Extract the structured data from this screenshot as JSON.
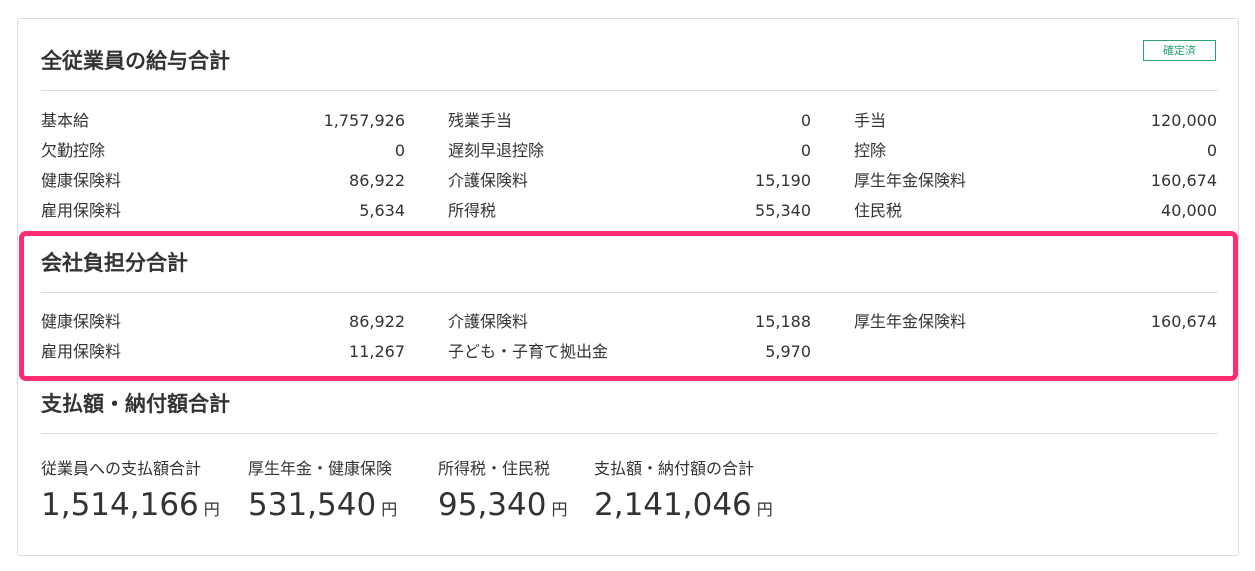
{
  "salary_total": {
    "title": "全従業員の給与合計",
    "status_badge": "確定済",
    "items": [
      {
        "label": "基本給",
        "value": "1,757,926"
      },
      {
        "label": "残業手当",
        "value": "0"
      },
      {
        "label": "手当",
        "value": "120,000"
      },
      {
        "label": "欠勤控除",
        "value": "0"
      },
      {
        "label": "遅刻早退控除",
        "value": "0"
      },
      {
        "label": "控除",
        "value": "0"
      },
      {
        "label": "健康保険料",
        "value": "86,922"
      },
      {
        "label": "介護保険料",
        "value": "15,190"
      },
      {
        "label": "厚生年金保険料",
        "value": "160,674"
      },
      {
        "label": "雇用保険料",
        "value": "5,634"
      },
      {
        "label": "所得税",
        "value": "55,340"
      },
      {
        "label": "住民税",
        "value": "40,000"
      }
    ]
  },
  "company_burden": {
    "title": "会社負担分合計",
    "items": [
      {
        "label": "健康保険料",
        "value": "86,922"
      },
      {
        "label": "介護保険料",
        "value": "15,188"
      },
      {
        "label": "厚生年金保険料",
        "value": "160,674"
      },
      {
        "label": "雇用保険料",
        "value": "11,267"
      },
      {
        "label": "子ども・子育て拠出金",
        "value": "5,970"
      }
    ]
  },
  "payment_total": {
    "title": "支払額・納付額合計",
    "unit": "円",
    "items": [
      {
        "label": "従業員への支払額合計",
        "value": "1,514,166"
      },
      {
        "label": "厚生年金・健康保険",
        "value": "531,540"
      },
      {
        "label": "所得税・住民税",
        "value": "95,340"
      },
      {
        "label": "支払額・納付額の合計",
        "value": "2,141,046"
      }
    ]
  },
  "colors": {
    "highlight_border": "#ff2d6f",
    "badge_green": "#27a36e",
    "text": "#333333"
  }
}
